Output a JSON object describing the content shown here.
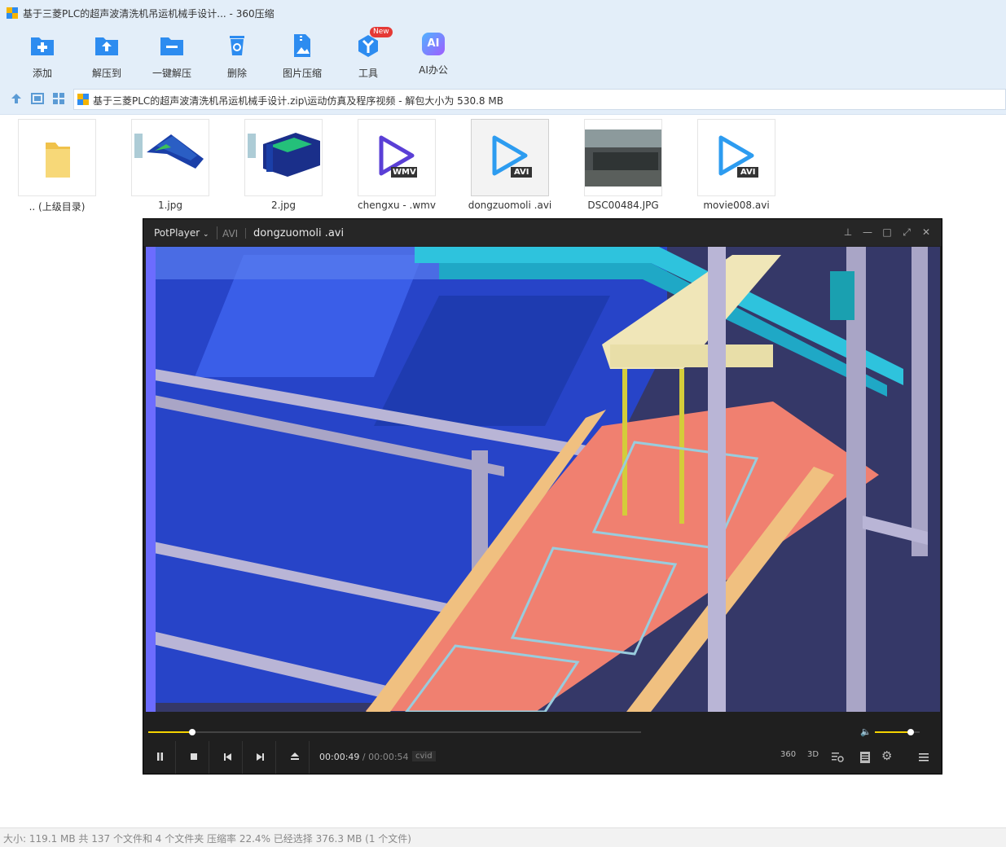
{
  "window": {
    "title": "基于三菱PLC的超声波清洗机吊运机械手设计... - 360压缩"
  },
  "toolbar": {
    "items": [
      {
        "label": "添加",
        "icon": "add-folder-icon"
      },
      {
        "label": "解压到",
        "icon": "extract-to-icon"
      },
      {
        "label": "一键解压",
        "icon": "one-click-extract-icon"
      },
      {
        "label": "删除",
        "icon": "delete-icon"
      },
      {
        "label": "图片压缩",
        "icon": "image-compress-icon"
      },
      {
        "label": "工具",
        "icon": "tools-icon",
        "badge": "New"
      },
      {
        "label": "AI办公",
        "icon": "ai-office-icon",
        "glyph": "AI"
      }
    ]
  },
  "address": {
    "path": "基于三菱PLC的超声波清洗机吊运机械手设计.zip\\运动仿真及程序视频 - 解包大小为 530.8 MB"
  },
  "files": [
    {
      "name": ".. (上级目录)",
      "kind": "folder"
    },
    {
      "name": "1.jpg",
      "kind": "image-cad"
    },
    {
      "name": "2.jpg",
      "kind": "image-cad2"
    },
    {
      "name": "chengxu - .wmv",
      "kind": "video",
      "badge": "WMV"
    },
    {
      "name": "dongzuomoli .avi",
      "kind": "video",
      "badge": "AVI",
      "selected": true
    },
    {
      "name": "DSC00484.JPG",
      "kind": "photo"
    },
    {
      "name": "movie008.avi",
      "kind": "video",
      "badge": "AVI"
    }
  ],
  "player": {
    "brand": "PotPlayer",
    "format": "AVI",
    "filename": "dongzuomoli .avi",
    "time_current": "00:00:49",
    "time_sep": "/",
    "time_total": "00:00:54",
    "codec": "cvid",
    "progress": 0.089,
    "volume": 0.8,
    "icons_right": [
      "360",
      "3D"
    ]
  },
  "status": {
    "text": "大小: 119.1 MB 共 137 个文件和 4 个文件夹 压缩率 22.4% 已经选择 376.3 MB (1 个文件)"
  },
  "colors": {
    "chrome": "#e3eef9",
    "accent": "#2d8cf0",
    "player_bg": "#1f1f1f",
    "progress": "#f5d300"
  }
}
